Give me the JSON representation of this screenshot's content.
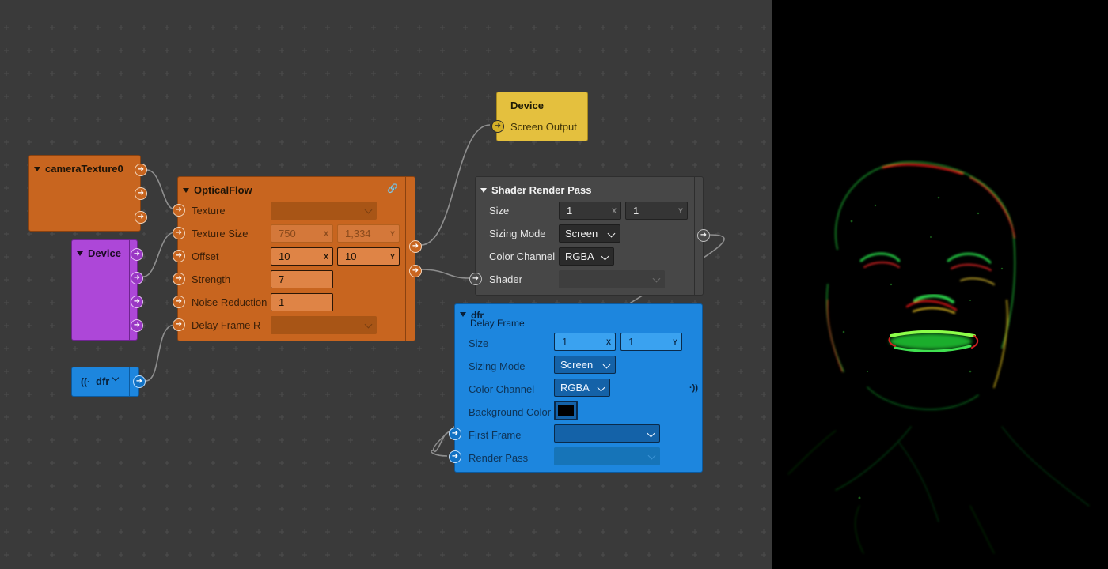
{
  "colors": {
    "canvas_bg": "#3a3a3a",
    "orange_node": "#c8651f",
    "purple_node": "#ad47d8",
    "blue_node": "#1d86de",
    "yellow_node": "#e4c03e",
    "gray_node": "#474747",
    "wire": "#909090"
  },
  "nodes": {
    "camera": {
      "title": "cameraTexture0"
    },
    "device_purple": {
      "title": "Device"
    },
    "dfr_small": {
      "title": "dfr",
      "icon": "broadcast-icon"
    },
    "optical": {
      "title": "OpticalFlow",
      "link_icon": "link-icon",
      "texture_label": "Texture",
      "texture_size_label": "Texture Size",
      "texture_size_x": "750",
      "texture_size_y": "1,334",
      "offset_label": "Offset",
      "offset_x": "10",
      "offset_y": "10",
      "strength_label": "Strength",
      "strength_value": "7",
      "noise_label": "Noise Reduction",
      "noise_value": "1",
      "delay_label": "Delay Frame R",
      "x_axis": "X",
      "y_axis": "Y"
    },
    "device_yellow": {
      "title": "Device",
      "output_label": "Screen Output"
    },
    "shader": {
      "title": "Shader Render Pass",
      "size_label": "Size",
      "size_x": "1",
      "size_y": "1",
      "sizing_label": "Sizing Mode",
      "sizing_value": "Screen",
      "channel_label": "Color Channel",
      "channel_value": "RGBA",
      "shader_label": "Shader",
      "x_axis": "X",
      "y_axis": "Y"
    },
    "dfr_big": {
      "title": "dfr",
      "subtitle": "Delay Frame",
      "size_label": "Size",
      "size_x": "1",
      "size_y": "1",
      "sizing_label": "Sizing Mode",
      "sizing_value": "Screen",
      "channel_label": "Color Channel",
      "channel_value": "RGBA",
      "bg_label": "Background Color",
      "bg_color": "#000000",
      "first_frame_label": "First Frame",
      "render_pass_label": "Render Pass",
      "x_axis": "X",
      "y_axis": "Y",
      "broadcast_icon": "broadcast-icon"
    }
  }
}
